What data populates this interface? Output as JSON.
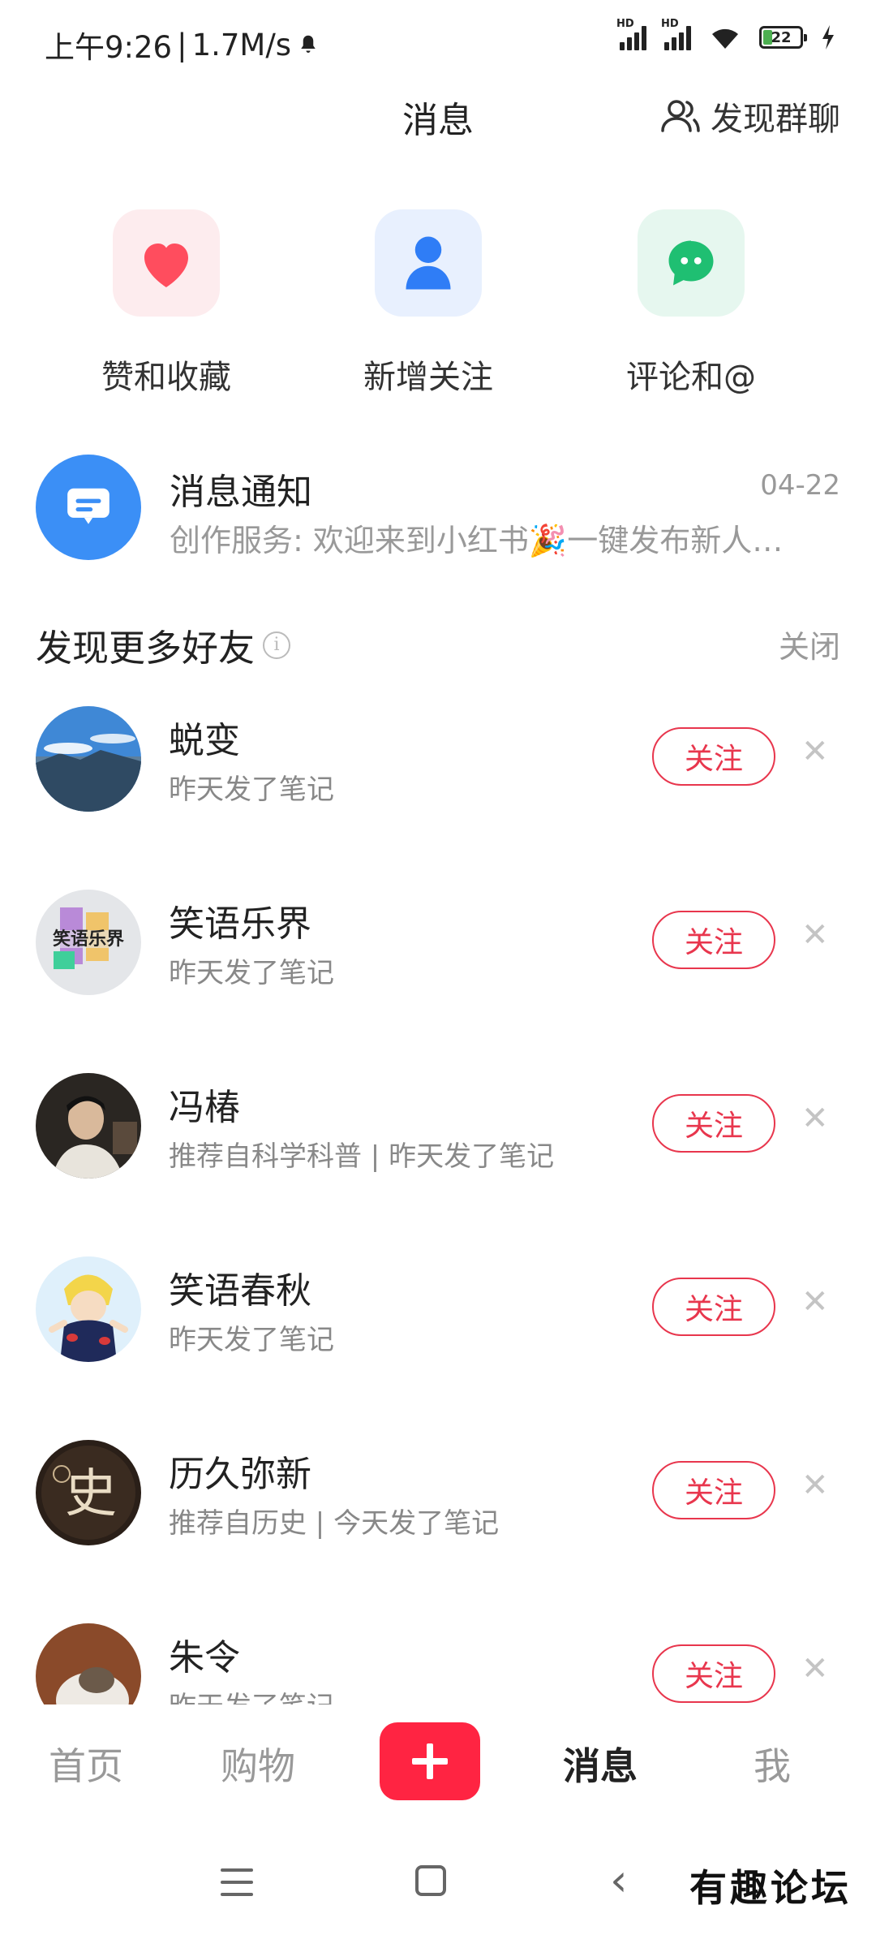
{
  "status_bar": {
    "time": "上午9:26",
    "speed": "1.7M/s",
    "battery": "22"
  },
  "header": {
    "title": "消息",
    "discover_group": "发现群聊"
  },
  "quick_entries": [
    {
      "label": "赞和收藏",
      "icon": "heart-icon",
      "color": "#ff4d5e",
      "bg": "#fdecee"
    },
    {
      "label": "新增关注",
      "icon": "person-icon",
      "color": "#2f7df6",
      "bg": "#e8f0fe"
    },
    {
      "label": "评论和@",
      "icon": "chat-bubble-icon",
      "color": "#1fbf72",
      "bg": "#e6f7ef"
    }
  ],
  "notification": {
    "title": "消息通知",
    "date": "04-22",
    "preview": "创作服务: 欢迎来到小红书🎉一键发布新人…"
  },
  "find_friends": {
    "title": "发现更多好友",
    "close": "关闭"
  },
  "friends": [
    {
      "name": "蜕变",
      "sub": "昨天发了笔记",
      "follow": "关注"
    },
    {
      "name": "笑语乐界",
      "sub": "昨天发了笔记",
      "follow": "关注"
    },
    {
      "name": "冯椿",
      "sub": "推荐自科学科普 | 昨天发了笔记",
      "follow": "关注"
    },
    {
      "name": "笑语春秋",
      "sub": "昨天发了笔记",
      "follow": "关注"
    },
    {
      "name": "历久弥新",
      "sub": "推荐自历史 | 今天发了笔记",
      "follow": "关注"
    },
    {
      "name": "朱令",
      "sub": "昨天发了笔记",
      "follow": "关注"
    }
  ],
  "tabbar": {
    "home": "首页",
    "shop": "购物",
    "post": "+",
    "messages": "消息",
    "me": "我"
  },
  "watermark": "有趣论坛",
  "colors": {
    "accent": "#ff2442",
    "follow": "#e8364d"
  }
}
